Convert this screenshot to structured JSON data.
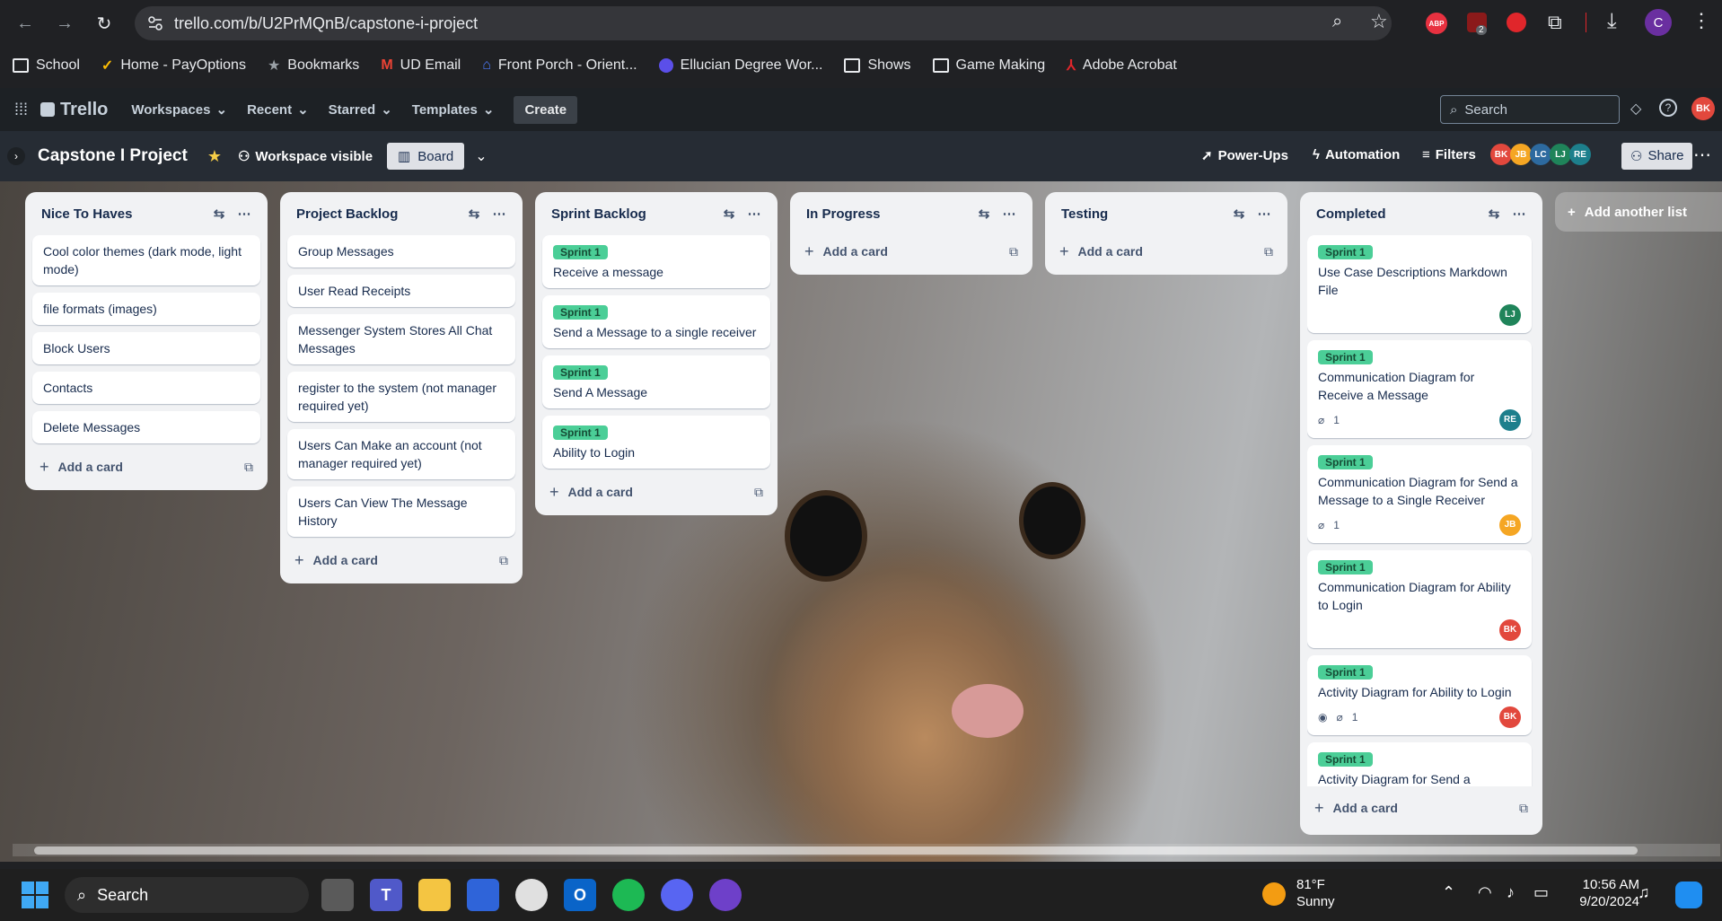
{
  "browser": {
    "url": "trello.com/b/U2PrMQnB/capstone-i-project",
    "bookmarks": [
      "School",
      "Home - PayOptions",
      "Bookmarks",
      "UD Email",
      "Front Porch - Orient...",
      "Ellucian Degree Wor...",
      "Shows",
      "Game Making",
      "Adobe Acrobat"
    ],
    "extension_badge": "2",
    "profile_initial": "C"
  },
  "header": {
    "logo": "Trello",
    "menus": [
      "Workspaces",
      "Recent",
      "Starred",
      "Templates"
    ],
    "create": "Create",
    "search_placeholder": "Search",
    "user_initials": "BK"
  },
  "board": {
    "title": "Capstone I Project",
    "visibility": "Workspace visible",
    "view": "Board",
    "powerups": "Power-Ups",
    "automation": "Automation",
    "filters": "Filters",
    "share": "Share",
    "members": [
      {
        "initials": "BK",
        "color": "#e2483d"
      },
      {
        "initials": "JB",
        "color": "#f5a623"
      },
      {
        "initials": "LC",
        "color": "#2d6a9f"
      },
      {
        "initials": "LJ",
        "color": "#1f845a"
      },
      {
        "initials": "RE",
        "color": "#1d7f8c"
      }
    ]
  },
  "add_card_label": "Add a card",
  "add_list_label": "Add another list",
  "lists": [
    {
      "title": "Nice To Haves",
      "cards": [
        "Cool color themes (dark mode, light mode)",
        "file formats (images)",
        "Block Users",
        "Contacts",
        "Delete Messages"
      ]
    },
    {
      "title": "Project Backlog",
      "cards": [
        "Group Messages",
        "User Read Receipts",
        "Messenger System Stores All Chat Messages",
        "register to the system (not manager required yet)",
        "Users Can Make an account (not manager required yet)",
        "Users Can View The Message History"
      ]
    },
    {
      "title": "Sprint Backlog",
      "label": "Sprint 1",
      "cards": [
        "Receive a message",
        "Send a Message to a single receiver",
        "Send A Message",
        "Ability to Login"
      ]
    },
    {
      "title": "In Progress",
      "cards": []
    },
    {
      "title": "Testing",
      "cards": []
    },
    {
      "title": "Completed",
      "label": "Sprint 1",
      "cards": [
        {
          "text": "Use Case Descriptions Markdown File",
          "attach": "",
          "avatar": "LJ",
          "avatar_color": "#1f845a"
        },
        {
          "text": "Communication Diagram for Receive a Message",
          "attach": "1",
          "avatar": "RE",
          "avatar_color": "#1d7f8c"
        },
        {
          "text": "Communication Diagram for Send a Message to a Single Receiver",
          "attach": "1",
          "avatar": "JB",
          "avatar_color": "#f5a623"
        },
        {
          "text": "Communication Diagram for Ability to Login",
          "attach": "",
          "avatar": "BK",
          "avatar_color": "#e2483d"
        },
        {
          "text": "Activity Diagram for Ability to Login",
          "attach": "1",
          "avatar": "BK",
          "avatar_color": "#e2483d"
        },
        {
          "text": "Activity Diagram for Send a Message to a Single Receiver",
          "attach": "",
          "avatar": "",
          "avatar_color": ""
        }
      ]
    }
  ],
  "taskbar": {
    "search": "Search",
    "weather_temp": "81°F",
    "weather_desc": "Sunny",
    "time": "10:56 AM",
    "date": "9/20/2024"
  }
}
